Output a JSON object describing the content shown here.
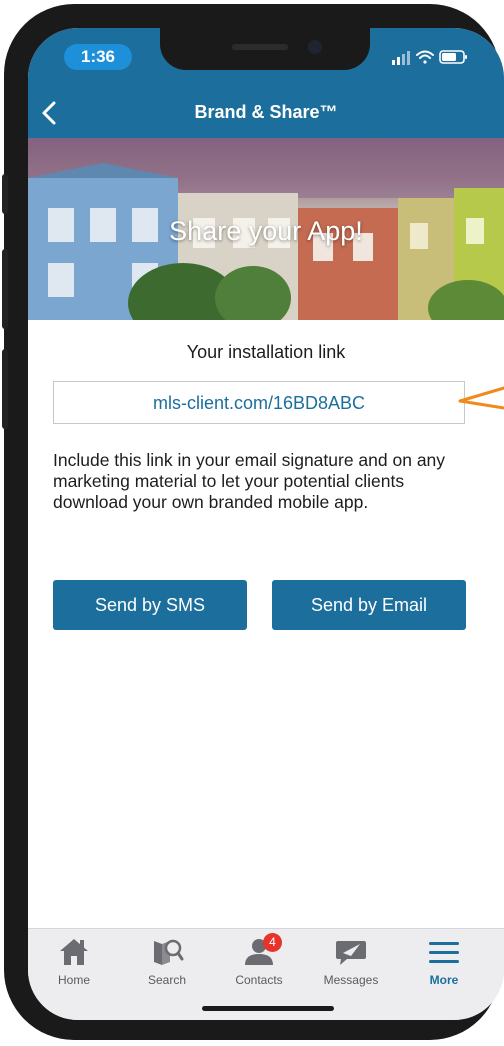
{
  "status": {
    "time": "1:36"
  },
  "nav": {
    "title": "Brand & Share™"
  },
  "hero": {
    "title": "Share your App!"
  },
  "content": {
    "link_label": "Your installation link",
    "link_value": "mls-client.com/16BD8ABC",
    "description": "Include this link in your email signature and on any marketing material to let your potential clients download your own branded mobile app.",
    "sms_button": "Send by SMS",
    "email_button": "Send by Email"
  },
  "tabs": [
    {
      "label": "Home",
      "icon": "home-icon"
    },
    {
      "label": "Search",
      "icon": "search-icon"
    },
    {
      "label": "Contacts",
      "icon": "contacts-icon",
      "badge": "4"
    },
    {
      "label": "Messages",
      "icon": "messages-icon"
    },
    {
      "label": "More",
      "icon": "menu-icon",
      "active": true
    }
  ],
  "colors": {
    "brand": "#1c6f9d",
    "badge": "#e8332a",
    "annotation_arrow": "#f08a1c"
  }
}
